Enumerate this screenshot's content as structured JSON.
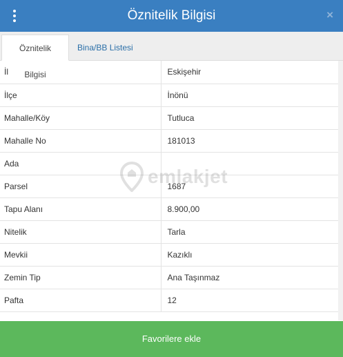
{
  "header": {
    "title": "Öznitelik Bilgisi",
    "close_symbol": "×",
    "menu_icon": "vertical-dots-icon"
  },
  "tabs": [
    {
      "label": "Öznitelik Bilgisi",
      "active": true
    },
    {
      "label": "Bina/BB Listesi",
      "active": false
    }
  ],
  "rows": [
    {
      "key": "İl",
      "value": "Eskişehir"
    },
    {
      "key": "İlçe",
      "value": "İnönü"
    },
    {
      "key": "Mahalle/Köy",
      "value": "Tutluca"
    },
    {
      "key": "Mahalle No",
      "value": "181013"
    },
    {
      "key": "Ada",
      "value": ""
    },
    {
      "key": "Parsel",
      "value": "1687"
    },
    {
      "key": "Tapu Alanı",
      "value": "8.900,00"
    },
    {
      "key": "Nitelik",
      "value": "Tarla"
    },
    {
      "key": "Mevkii",
      "value": "Kazıklı"
    },
    {
      "key": "Zemin Tip",
      "value": "Ana Taşınmaz"
    },
    {
      "key": "Pafta",
      "value": "12"
    }
  ],
  "watermark": {
    "text": "emlakjet"
  },
  "footer": {
    "button_label": "Favorilere ekle"
  },
  "colors": {
    "header": "#3a7fc1",
    "button": "#5cb85c",
    "link": "#2b6fa8"
  }
}
